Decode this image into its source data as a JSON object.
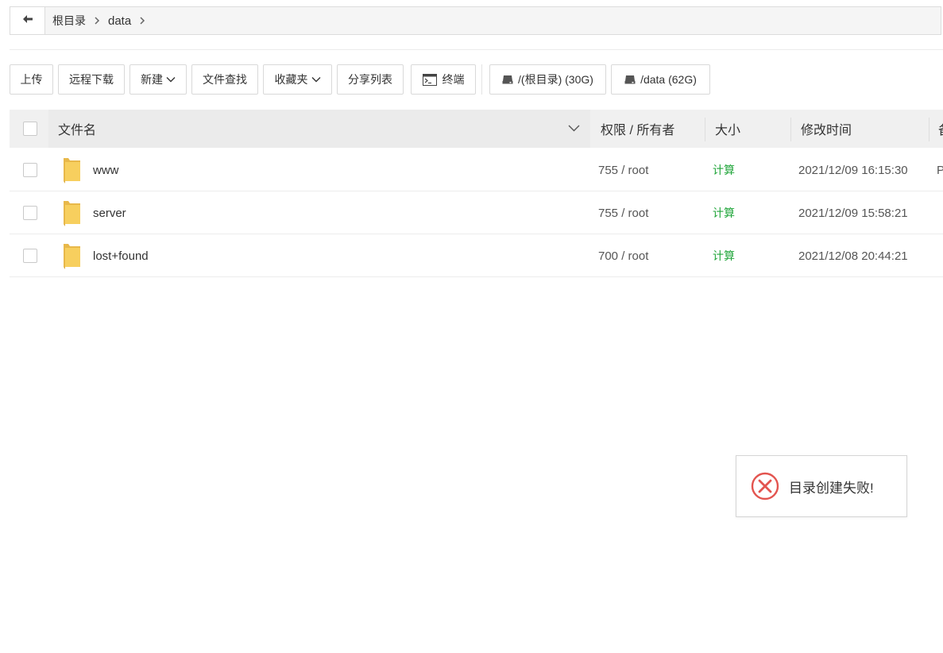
{
  "breadcrumb": {
    "items": [
      "根目录",
      "data"
    ]
  },
  "toolbar": {
    "upload": "上传",
    "remote_download": "远程下载",
    "new": "新建",
    "file_search": "文件查找",
    "favorites": "收藏夹",
    "share_list": "分享列表",
    "terminal": "终端",
    "disk_root": "/(根目录) (30G)",
    "disk_data": "/data (62G)"
  },
  "table": {
    "columns": [
      "文件名",
      "权限 / 所有者",
      "大小",
      "修改时间",
      "备"
    ],
    "rows": [
      {
        "name": "www",
        "perm": "755 / root",
        "size": "计算",
        "mtime": "2021/12/09 16:15:30",
        "extra": "P"
      },
      {
        "name": "server",
        "perm": "755 / root",
        "size": "计算",
        "mtime": "2021/12/09 15:58:21",
        "extra": ""
      },
      {
        "name": "lost+found",
        "perm": "700 / root",
        "size": "计算",
        "mtime": "2021/12/08 20:44:21",
        "extra": ""
      }
    ]
  },
  "toast": {
    "message": "目录创建失败!"
  },
  "colors": {
    "accent_green": "#20a53a",
    "error_red": "#e3544f",
    "folder_yellow": "#f7cf5e"
  }
}
